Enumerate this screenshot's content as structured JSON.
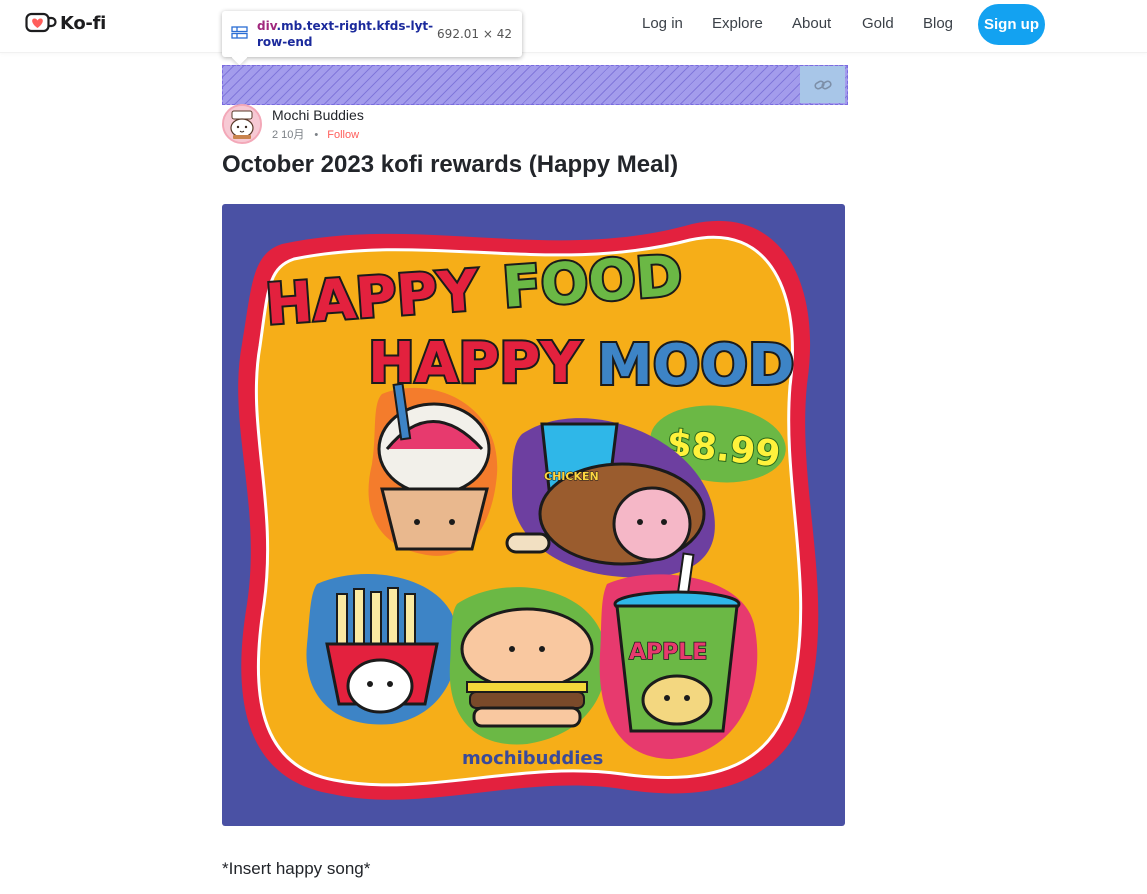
{
  "header": {
    "logo_text": "Ko-fi",
    "nav": [
      "Log in",
      "Explore",
      "About",
      "Gold",
      "Blog"
    ],
    "signup_label": "Sign up"
  },
  "devtools_tooltip": {
    "tag": "div",
    "classes": ".mb.text-right.kfds-lyt-row-end",
    "dimensions": "692.01 × 42"
  },
  "post": {
    "author": "Mochi Buddies",
    "date": "2 10月",
    "follow_label": "Follow",
    "title": "October 2023 kofi rewards (Happy Meal)",
    "body": "*Insert happy song*",
    "image": {
      "headline_line1_a": "HAPPY",
      "headline_line1_b": "FOOD",
      "headline_line2_a": "HAPPY",
      "headline_line2_b": "MOOD",
      "price": "$8.99",
      "drink_label": "APPLE",
      "bucket_label": "CHICKEN",
      "brand": "mochibuddies"
    }
  },
  "colors": {
    "accent": "#13a2f1",
    "follow": "#ff5e5b",
    "image_bg": "#4a51a4",
    "image_yellow": "#f6ae18",
    "image_red": "#e3213e"
  }
}
